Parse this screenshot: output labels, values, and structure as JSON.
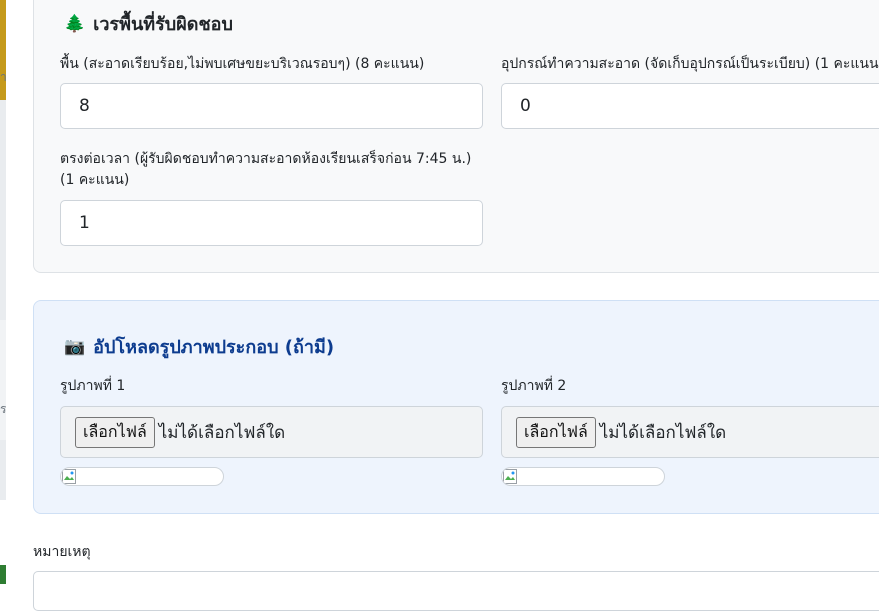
{
  "duty": {
    "title": "เวรพื้นที่รับผิดชอบ",
    "icon": "tree-icon",
    "floor": {
      "label": "พื้น (สะอาดเรียบร้อย,ไม่พบเศษขยะบริเวณรอบๆ) (8 คะแนน)",
      "value": "8"
    },
    "equipment": {
      "label": "อุปกรณ์ทำความสะอาด (จัดเก็บอุปกรณ์เป็นระเบียบ) (1 คะแนน",
      "value": "0"
    },
    "punctual": {
      "label": "ตรงต่อเวลา (ผู้รับผิดชอบทำความสะอาดห้องเรียนเสร็จก่อน 7:45 น.) (1 คะแนน)",
      "value": "1"
    }
  },
  "upload": {
    "title": "อัปโหลดรูปภาพประกอบ (ถ้ามี)",
    "icon": "camera-icon",
    "photo1": {
      "label": "รูปภาพที่ 1",
      "button": "เลือกไฟล์",
      "status": "ไม่ได้เลือกไฟล์ใด"
    },
    "photo2": {
      "label": "รูปภาพที่ 2",
      "button": "เลือกไฟล์",
      "status": "ไม่ได้เลือกไฟล์ใด"
    }
  },
  "note": {
    "label": "หมายเหตุ"
  },
  "sidebar": {
    "fragment1": "า",
    "fragment2": "ร"
  }
}
